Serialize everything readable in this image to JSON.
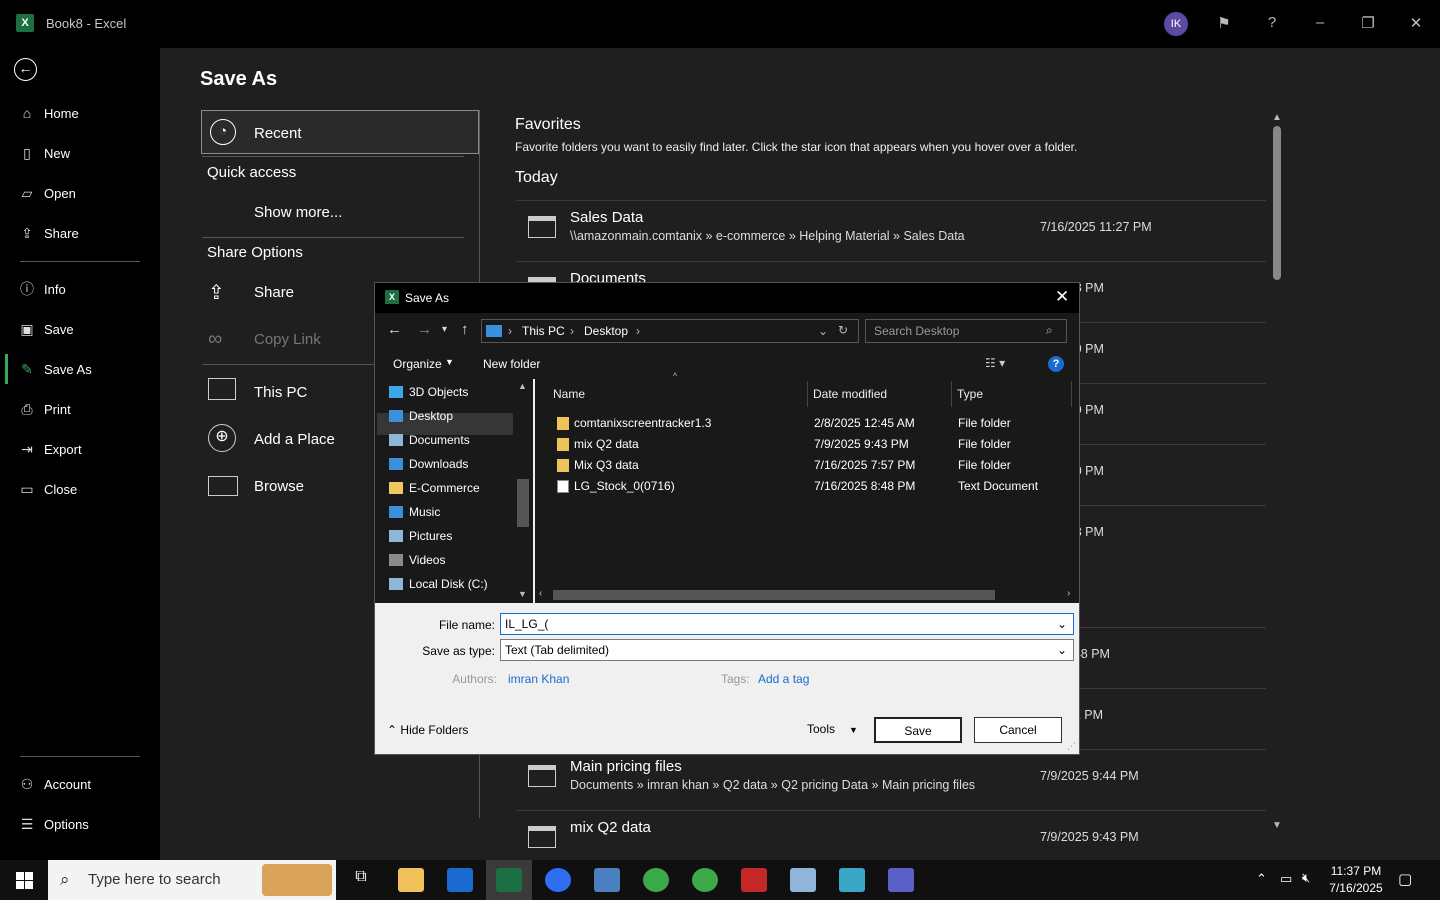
{
  "window": {
    "title": "Book8 - Excel",
    "user_initials": "IK",
    "app_icon_letter": "X"
  },
  "sidebar": {
    "items": [
      {
        "label": "Home",
        "icon": "home-icon"
      },
      {
        "label": "New",
        "icon": "new-doc-icon"
      },
      {
        "label": "Open",
        "icon": "folder-open-icon"
      },
      {
        "label": "Share",
        "icon": "share-icon"
      },
      {
        "label": "Info",
        "icon": "info-icon"
      },
      {
        "label": "Save",
        "icon": "save-icon"
      },
      {
        "label": "Save As",
        "icon": "save-as-icon"
      },
      {
        "label": "Print",
        "icon": "print-icon"
      },
      {
        "label": "Export",
        "icon": "export-icon"
      },
      {
        "label": "Close",
        "icon": "close-doc-icon"
      },
      {
        "label": "Account",
        "icon": "account-icon"
      },
      {
        "label": "Options",
        "icon": "options-icon"
      }
    ]
  },
  "saveas": {
    "title": "Save As",
    "recent": "Recent",
    "quick_access": "Quick access",
    "show_more": "Show more...",
    "share_options": "Share Options",
    "share": "Share",
    "copy_link": "Copy Link",
    "this_pc": "This PC",
    "add_place": "Add a Place",
    "browse": "Browse"
  },
  "favorites": {
    "title": "Favorites",
    "desc": "Favorite folders you want to easily find later. Click the star icon that appears when you hover over a folder.",
    "today": "Today",
    "rows": [
      {
        "name": "Sales Data",
        "path": "\\\\amazonmain.comtanix » e-commerce » Helping Material » Sales Data",
        "date": "7/16/2025 11:27 PM"
      },
      {
        "name": "Documents",
        "path": "",
        "date": "25 9:58 PM"
      },
      {
        "name": "",
        "path": "",
        "date": "25 9:39 PM"
      },
      {
        "name": "",
        "path": "",
        "date": "25 9:29 PM"
      },
      {
        "name": "",
        "path": "",
        "date": "25 8:10 PM"
      },
      {
        "name": "",
        "path": "",
        "date": "25 7:23 PM"
      },
      {
        "name": "",
        "path": "",
        "date": "25 11:48 PM"
      },
      {
        "name": "",
        "path": "",
        "date": "5 11:42 PM"
      },
      {
        "name": "Main pricing files",
        "path": "Documents » imran khan » Q2 data » Q2 pricing Data » Main pricing files",
        "date": "7/9/2025 9:44 PM"
      },
      {
        "name": "mix Q2 data",
        "path": "",
        "date": "7/9/2025 9:43 PM"
      }
    ]
  },
  "dialog": {
    "title": "Save As",
    "addr": [
      "This PC",
      "Desktop"
    ],
    "search_placeholder": "Search Desktop",
    "organize": "Organize",
    "new_folder": "New folder",
    "help": "?",
    "tree": [
      {
        "label": "3D Objects",
        "color": "#3ba7e6"
      },
      {
        "label": "Desktop",
        "color": "#3b8fe0"
      },
      {
        "label": "Documents",
        "color": "#8fb6d8"
      },
      {
        "label": "Downloads",
        "color": "#3b8fe0"
      },
      {
        "label": "E-Commerce",
        "color": "#f0c75e"
      },
      {
        "label": "Music",
        "color": "#3b8fe0"
      },
      {
        "label": "Pictures",
        "color": "#8fb6d8"
      },
      {
        "label": "Videos",
        "color": "#8a8a8a"
      },
      {
        "label": "Local Disk (C:)",
        "color": "#8fb6d8"
      }
    ],
    "cols": {
      "name": "Name",
      "date": "Date modified",
      "type": "Type"
    },
    "files": [
      {
        "name": "comtanixscreentracker1.3",
        "date": "2/8/2025 12:45 AM",
        "type": "File folder",
        "icon": "folder-icon"
      },
      {
        "name": "mix Q2 data",
        "date": "7/9/2025 9:43 PM",
        "type": "File folder",
        "icon": "folder-icon"
      },
      {
        "name": "Mix Q3 data",
        "date": "7/16/2025 7:57 PM",
        "type": "File folder",
        "icon": "folder-icon"
      },
      {
        "name": "LG_Stock_0(0716)",
        "date": "7/16/2025 8:48 PM",
        "type": "Text Document",
        "icon": "text-file-icon"
      }
    ],
    "file_name_label": "File name:",
    "file_name_value": "IL_LG_(",
    "save_type_label": "Save as type:",
    "save_type_value": "Text (Tab delimited)",
    "authors_label": "Authors:",
    "authors_value": "imran Khan",
    "tags_label": "Tags:",
    "tags_value": "Add a tag",
    "hide_folders": "Hide Folders",
    "tools": "Tools",
    "save": "Save",
    "cancel": "Cancel"
  },
  "taskbar": {
    "search_placeholder": "Type here to search",
    "time": "11:37 PM",
    "date": "7/16/2025"
  }
}
